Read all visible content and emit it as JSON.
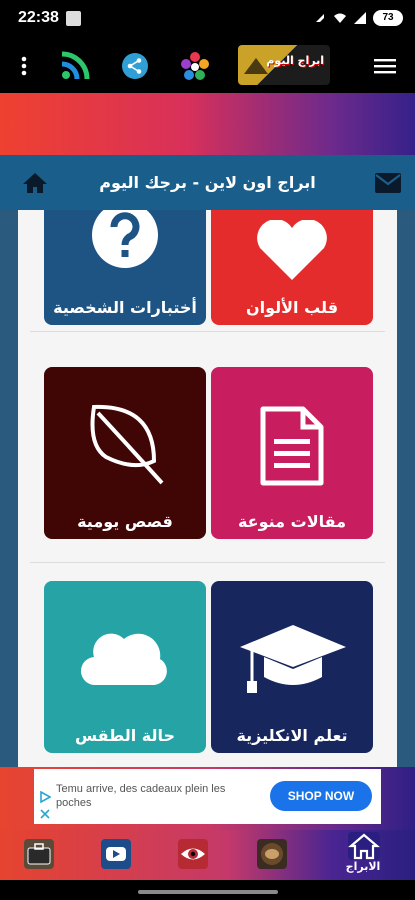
{
  "status_bar": {
    "time": "22:38",
    "battery": "73"
  },
  "header": {
    "title": "ابراج اون لاين - برجك اليوم",
    "logo_text": "ابراج اليوم"
  },
  "tiles": [
    {
      "label": "قلب الألوان",
      "color": "#e52c2c",
      "icon": "heart-icon"
    },
    {
      "label": "أختبارات الشخصية",
      "color": "#1d5483",
      "icon": "question-icon"
    },
    {
      "label": "مقالات منوعة",
      "color": "#c81e5f",
      "icon": "document-icon"
    },
    {
      "label": "قصص يومية",
      "color": "#3f0605",
      "icon": "leaf-icon"
    },
    {
      "label": "تعلم الانكليزية",
      "color": "#17275e",
      "icon": "graduation-cap-icon"
    },
    {
      "label": "حالة الطقس",
      "color": "#26a3a5",
      "icon": "cloud-icon"
    }
  ],
  "ad": {
    "text": "Temu arrive, des cadeaux plein les poches",
    "button": "SHOP NOW"
  },
  "bottom_nav": {
    "home_label": "الابراج",
    "items": [
      "briefcase-icon",
      "youtube-icon",
      "eye-icon",
      "coffee-cup-icon",
      "home-icon"
    ]
  },
  "colors": {
    "title_bar": "#1a5e8c",
    "ad_button": "#1a73e8"
  }
}
